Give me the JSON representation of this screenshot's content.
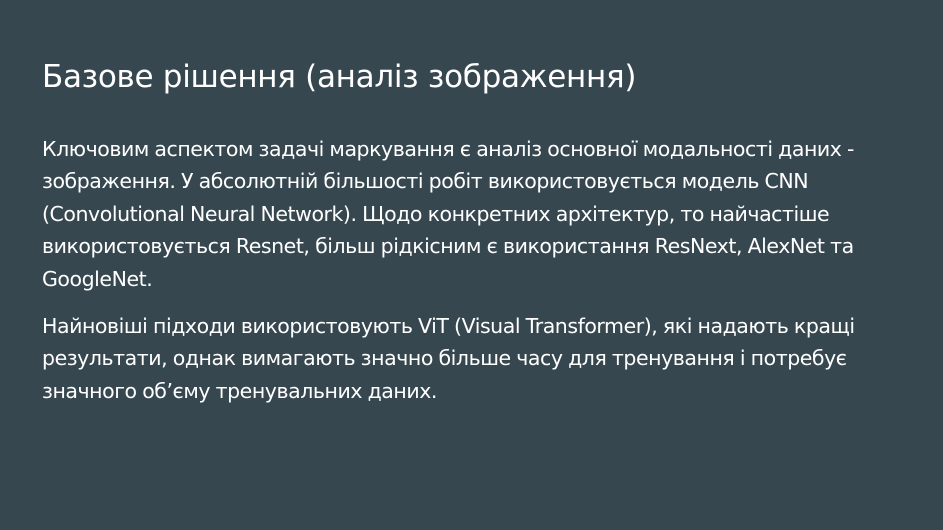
{
  "slide": {
    "title": "Базове рішення (аналіз зображення)",
    "paragraphs": [
      "Ключовим аспектом задачі маркування є аналіз основної модальності даних - зображення. У абсолютній більшості робіт використовується модель CNN (Convolutional Neural Network). Щодо конкретних архітектур, то найчастіше використовується Resnet, більш рідкісним є використання ResNext, AlexNet та GoogleNet.",
      "Найновіші підходи використовують ViT (Visual Transformer), які надають кращі результати, однак вимагають значно більше часу для тренування і потребує значного об’єму тренувальних даних."
    ]
  },
  "colors": {
    "background": "#37474f",
    "text": "#ffffff"
  }
}
